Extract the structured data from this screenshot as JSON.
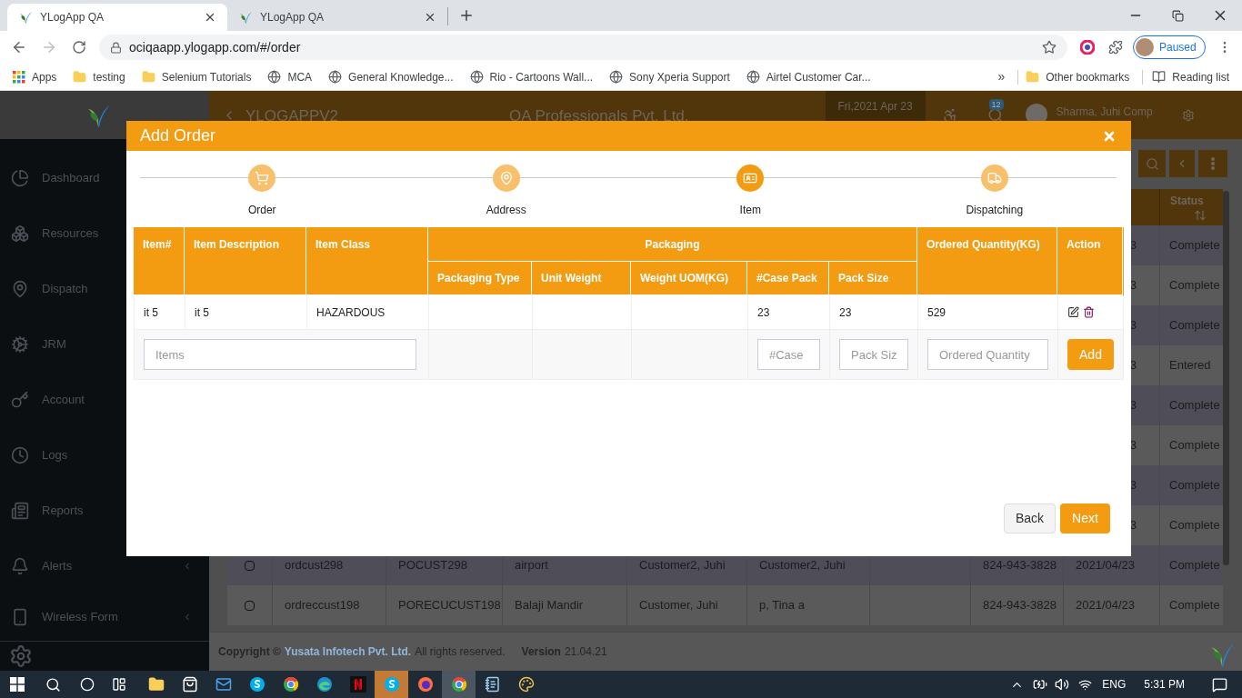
{
  "browser": {
    "tabs": [
      {
        "title": "YLogApp QA",
        "selected": true
      },
      {
        "title": "YLogApp QA",
        "selected": false
      }
    ],
    "url": "ociqaapp.ylogapp.com/#/order",
    "profile_status": "Paused",
    "bookmarks": [
      {
        "label": "Apps",
        "kind": "apps"
      },
      {
        "label": "testing",
        "kind": "folder"
      },
      {
        "label": "Selenium Tutorials",
        "kind": "folder"
      },
      {
        "label": "MCA",
        "kind": "globe"
      },
      {
        "label": "General Knowledge...",
        "kind": "globe"
      },
      {
        "label": "Rio - Cartoons Wall...",
        "kind": "globe"
      },
      {
        "label": "Sony Xperia Support",
        "kind": "globe"
      },
      {
        "label": "Airtel Customer Car...",
        "kind": "globe"
      }
    ],
    "more_bookmarks": "»",
    "other_bookmarks": "Other bookmarks",
    "reading_list": "Reading list"
  },
  "app_header": {
    "app_name": "YLOGAPPV2",
    "company": "QA Professionals Pvt. Ltd.",
    "date": "Fri,2021 Apr 23",
    "notification_count": "12",
    "user": "Sharma, Juhi Comp"
  },
  "sidebar": {
    "items": [
      {
        "label": "Dashboard",
        "kind": "dashboard",
        "has_submenu": false
      },
      {
        "label": "Resources",
        "kind": "resources",
        "has_submenu": false
      },
      {
        "label": "Dispatch",
        "kind": "dispatch",
        "has_submenu": false
      },
      {
        "label": "JRM",
        "kind": "jrm",
        "has_submenu": false
      },
      {
        "label": "Account",
        "kind": "account",
        "has_submenu": false
      },
      {
        "label": "Logs",
        "kind": "logs",
        "has_submenu": false
      },
      {
        "label": "Reports",
        "kind": "reports",
        "has_submenu": false
      },
      {
        "label": "Alerts",
        "kind": "alerts",
        "has_submenu": true
      },
      {
        "label": "Wireless Form",
        "kind": "wireless",
        "has_submenu": true
      }
    ]
  },
  "orders_table": {
    "status_header": "Status",
    "rows": [
      {
        "column_9": "3",
        "status": "Complete"
      },
      {
        "column_9": "3",
        "status": "Complete"
      },
      {
        "column_9": "3",
        "status": "Complete"
      },
      {
        "column_9": "3",
        "status": "Entered"
      },
      {
        "column_9": "3",
        "status": "Complete"
      },
      {
        "column_9": "3",
        "status": "Complete"
      },
      {
        "column_9": "3",
        "status": "Complete"
      },
      {
        "column_9": "3",
        "status": "Complete"
      },
      {
        "checked": false,
        "column_2": "ordcust298",
        "column_3": "POCUST298",
        "column_4": "airport",
        "column_5": "Customer2, Juhi",
        "column_6": "Customer2, Juhi",
        "column_8": "824-943-3828",
        "column_9": "2021/04/23",
        "status": "Complete"
      },
      {
        "checked": false,
        "column_2": "ordreccust198",
        "column_3": "PORECUCUST198",
        "column_4": "Balaji Mandir",
        "column_5": "Customer, Juhi",
        "column_6": "p, Tina a",
        "column_8": "824-943-3828",
        "column_9": "2021/04/23",
        "status": "Complete"
      }
    ]
  },
  "footer": {
    "copyright": "Copyright ©",
    "company_link": "Yusata Infotech Pvt. Ltd.",
    "rights": "All rights reserved.",
    "version_label": "Version",
    "version": "21.04.21"
  },
  "dialog": {
    "title": "Add Order",
    "steps": [
      {
        "label": "Order",
        "kind": "cart",
        "selected": false
      },
      {
        "label": "Address",
        "kind": "pin",
        "selected": false
      },
      {
        "label": "Item",
        "kind": "card",
        "selected": true
      },
      {
        "label": "Dispatching",
        "kind": "truck",
        "selected": false
      }
    ],
    "columns": [
      {
        "label": "Item#"
      },
      {
        "label": "Item Description"
      },
      {
        "label": "Item Class"
      },
      {
        "label": "Packaging",
        "children": [
          {
            "label": "Packaging Type"
          },
          {
            "label": "Unit Weight"
          },
          {
            "label": "Weight UOM(KG)"
          },
          {
            "label": "#Case Pack"
          },
          {
            "label": "Pack Size"
          }
        ]
      },
      {
        "label": "Ordered Quantity(KG)"
      },
      {
        "label": "Action"
      }
    ],
    "rows": [
      {
        "item": "it 5",
        "description": "it 5",
        "item_class": "HAZARDOUS",
        "case_pack": "23",
        "pack_size": "23",
        "ordered_quantity": "529"
      }
    ],
    "new_item": {
      "items_placeholder": "Items",
      "case_pack_placeholder": "#Case",
      "pack_size_placeholder": "Pack Siz",
      "quantity_placeholder": "Ordered Quantity",
      "add_label": "Add"
    },
    "back_label": "Back",
    "next_label": "Next"
  },
  "taskbar": {
    "apps": [
      {
        "kind": "explorer",
        "active": false
      },
      {
        "kind": "store",
        "active": false
      },
      {
        "kind": "mail",
        "active": false
      },
      {
        "kind": "skype",
        "active": false
      },
      {
        "kind": "chrome",
        "active": false
      },
      {
        "kind": "edge",
        "active": false
      },
      {
        "kind": "netflix",
        "active": false
      },
      {
        "kind": "skype",
        "active": true
      },
      {
        "kind": "firefox",
        "active": false
      },
      {
        "kind": "chrome",
        "active": true
      },
      {
        "kind": "notepad",
        "active": false
      },
      {
        "kind": "paint",
        "active": false
      }
    ],
    "language": "ENG",
    "time": "5:31 PM"
  }
}
